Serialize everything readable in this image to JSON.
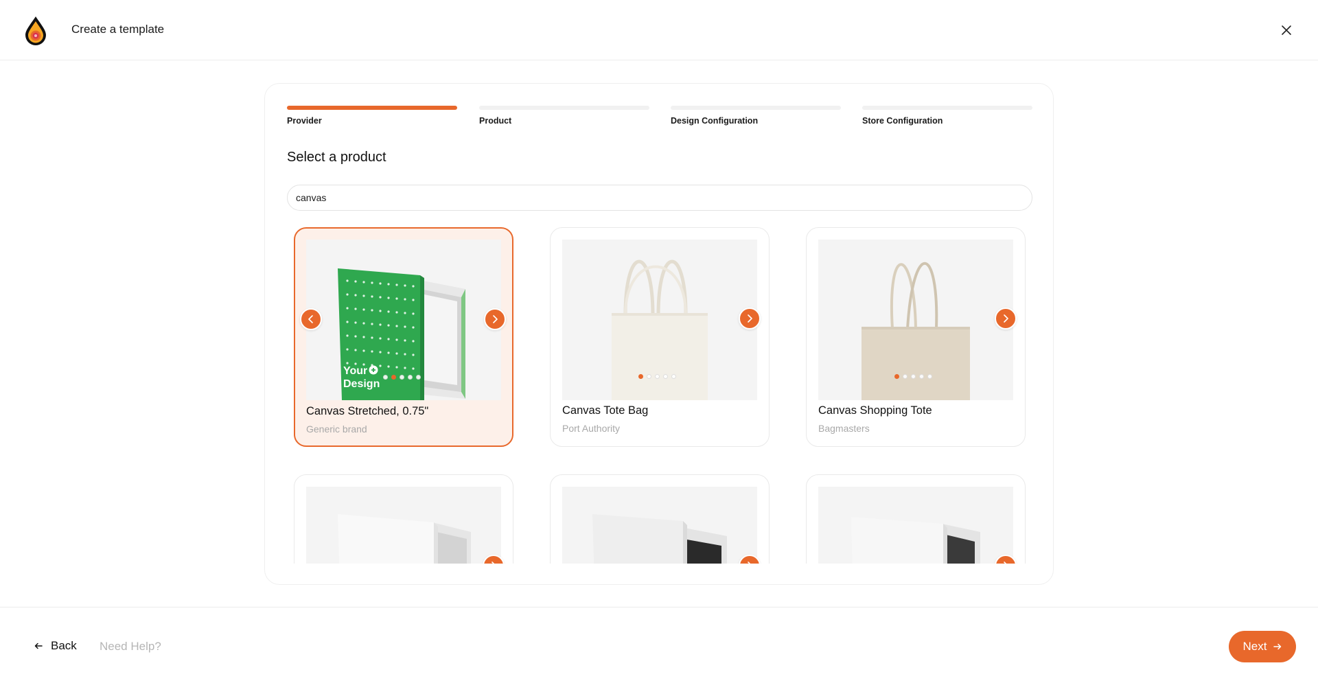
{
  "header": {
    "title": "Create a template",
    "logo_icon": "drop-logo-icon",
    "close_icon": "close-icon"
  },
  "steps": [
    {
      "label": "Provider",
      "active": true
    },
    {
      "label": "Product",
      "active": false
    },
    {
      "label": "Design Configuration",
      "active": false
    },
    {
      "label": "Store Configuration",
      "active": false
    }
  ],
  "main": {
    "title": "Select a product",
    "search": {
      "value": "canvas",
      "placeholder": ""
    }
  },
  "products": [
    {
      "name": "Canvas Stretched, 0.75\"",
      "brand": "Generic brand",
      "selected": true,
      "image": "canvas-stretched",
      "has_prev": true,
      "active_dot": 1,
      "dot_count": 5
    },
    {
      "name": "Canvas Tote Bag",
      "brand": "Port Authority",
      "selected": false,
      "image": "tote-bag",
      "has_prev": false,
      "active_dot": 0,
      "dot_count": 5
    },
    {
      "name": "Canvas Shopping Tote",
      "brand": "Bagmasters",
      "selected": false,
      "image": "shopping-tote",
      "has_prev": false,
      "active_dot": 0,
      "dot_count": 5
    },
    {
      "name": "",
      "brand": "",
      "selected": false,
      "image": "canvas-white",
      "has_prev": false,
      "active_dot": 0,
      "dot_count": 0
    },
    {
      "name": "",
      "brand": "",
      "selected": false,
      "image": "canvas-white-dark",
      "has_prev": false,
      "active_dot": 0,
      "dot_count": 0
    },
    {
      "name": "",
      "brand": "",
      "selected": false,
      "image": "canvas-white-dark",
      "has_prev": false,
      "active_dot": 0,
      "dot_count": 0
    }
  ],
  "footer": {
    "back_label": "Back",
    "help_label": "Need Help?",
    "next_label": "Next"
  },
  "colors": {
    "accent": "#e8682b",
    "selected_bg": "#fdf0e9",
    "muted_text": "#a8a8a8"
  }
}
